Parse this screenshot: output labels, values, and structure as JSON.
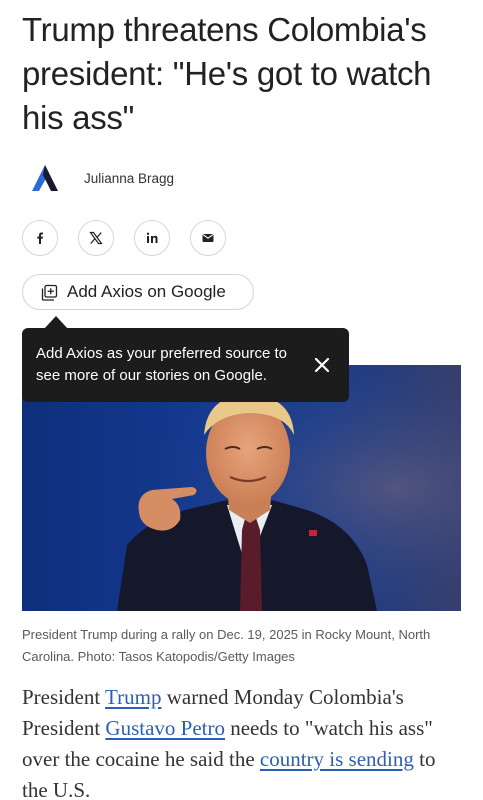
{
  "article": {
    "headline": "Trump threatens Colombia's president: \"He's got to watch his ass\"",
    "author": "Julianna Bragg",
    "add_source_label": "Add Axios on Google",
    "tooltip_text": "Add Axios as your preferred source to see more of our stories on Google.",
    "caption": "President Trump during a rally on Dec. 19, 2025 in Rocky Mount, North Carolina. Photo: Tasos Katopodis/Getty Images",
    "body": {
      "t1": "President ",
      "link1": "Trump",
      "t2": " warned Monday Colombia's President ",
      "link2": "Gustavo Petro",
      "t3": " needs to \"watch his ass\" over the cocaine he said the ",
      "link3": "country is sending",
      "t4": " to the U.S."
    }
  },
  "share": {
    "icons": [
      "facebook-icon",
      "x-icon",
      "linkedin-icon",
      "email-icon"
    ]
  },
  "colors": {
    "link": "#2c5fb3",
    "tooltip_bg": "#1c1c1c",
    "logo_blue": "#2a6bd8"
  }
}
